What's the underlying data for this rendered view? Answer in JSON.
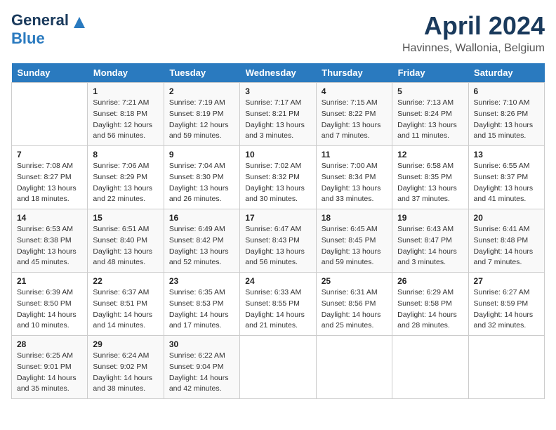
{
  "header": {
    "logo_general": "General",
    "logo_blue": "Blue",
    "month": "April 2024",
    "location": "Havinnes, Wallonia, Belgium"
  },
  "weekdays": [
    "Sunday",
    "Monday",
    "Tuesday",
    "Wednesday",
    "Thursday",
    "Friday",
    "Saturday"
  ],
  "weeks": [
    [
      {
        "day": "",
        "sunrise": "",
        "sunset": "",
        "daylight": ""
      },
      {
        "day": "1",
        "sunrise": "7:21 AM",
        "sunset": "8:18 PM",
        "daylight": "12 hours and 56 minutes."
      },
      {
        "day": "2",
        "sunrise": "7:19 AM",
        "sunset": "8:19 PM",
        "daylight": "12 hours and 59 minutes."
      },
      {
        "day": "3",
        "sunrise": "7:17 AM",
        "sunset": "8:21 PM",
        "daylight": "13 hours and 3 minutes."
      },
      {
        "day": "4",
        "sunrise": "7:15 AM",
        "sunset": "8:22 PM",
        "daylight": "13 hours and 7 minutes."
      },
      {
        "day": "5",
        "sunrise": "7:13 AM",
        "sunset": "8:24 PM",
        "daylight": "13 hours and 11 minutes."
      },
      {
        "day": "6",
        "sunrise": "7:10 AM",
        "sunset": "8:26 PM",
        "daylight": "13 hours and 15 minutes."
      }
    ],
    [
      {
        "day": "7",
        "sunrise": "7:08 AM",
        "sunset": "8:27 PM",
        "daylight": "13 hours and 18 minutes."
      },
      {
        "day": "8",
        "sunrise": "7:06 AM",
        "sunset": "8:29 PM",
        "daylight": "13 hours and 22 minutes."
      },
      {
        "day": "9",
        "sunrise": "7:04 AM",
        "sunset": "8:30 PM",
        "daylight": "13 hours and 26 minutes."
      },
      {
        "day": "10",
        "sunrise": "7:02 AM",
        "sunset": "8:32 PM",
        "daylight": "13 hours and 30 minutes."
      },
      {
        "day": "11",
        "sunrise": "7:00 AM",
        "sunset": "8:34 PM",
        "daylight": "13 hours and 33 minutes."
      },
      {
        "day": "12",
        "sunrise": "6:58 AM",
        "sunset": "8:35 PM",
        "daylight": "13 hours and 37 minutes."
      },
      {
        "day": "13",
        "sunrise": "6:55 AM",
        "sunset": "8:37 PM",
        "daylight": "13 hours and 41 minutes."
      }
    ],
    [
      {
        "day": "14",
        "sunrise": "6:53 AM",
        "sunset": "8:38 PM",
        "daylight": "13 hours and 45 minutes."
      },
      {
        "day": "15",
        "sunrise": "6:51 AM",
        "sunset": "8:40 PM",
        "daylight": "13 hours and 48 minutes."
      },
      {
        "day": "16",
        "sunrise": "6:49 AM",
        "sunset": "8:42 PM",
        "daylight": "13 hours and 52 minutes."
      },
      {
        "day": "17",
        "sunrise": "6:47 AM",
        "sunset": "8:43 PM",
        "daylight": "13 hours and 56 minutes."
      },
      {
        "day": "18",
        "sunrise": "6:45 AM",
        "sunset": "8:45 PM",
        "daylight": "13 hours and 59 minutes."
      },
      {
        "day": "19",
        "sunrise": "6:43 AM",
        "sunset": "8:47 PM",
        "daylight": "14 hours and 3 minutes."
      },
      {
        "day": "20",
        "sunrise": "6:41 AM",
        "sunset": "8:48 PM",
        "daylight": "14 hours and 7 minutes."
      }
    ],
    [
      {
        "day": "21",
        "sunrise": "6:39 AM",
        "sunset": "8:50 PM",
        "daylight": "14 hours and 10 minutes."
      },
      {
        "day": "22",
        "sunrise": "6:37 AM",
        "sunset": "8:51 PM",
        "daylight": "14 hours and 14 minutes."
      },
      {
        "day": "23",
        "sunrise": "6:35 AM",
        "sunset": "8:53 PM",
        "daylight": "14 hours and 17 minutes."
      },
      {
        "day": "24",
        "sunrise": "6:33 AM",
        "sunset": "8:55 PM",
        "daylight": "14 hours and 21 minutes."
      },
      {
        "day": "25",
        "sunrise": "6:31 AM",
        "sunset": "8:56 PM",
        "daylight": "14 hours and 25 minutes."
      },
      {
        "day": "26",
        "sunrise": "6:29 AM",
        "sunset": "8:58 PM",
        "daylight": "14 hours and 28 minutes."
      },
      {
        "day": "27",
        "sunrise": "6:27 AM",
        "sunset": "8:59 PM",
        "daylight": "14 hours and 32 minutes."
      }
    ],
    [
      {
        "day": "28",
        "sunrise": "6:25 AM",
        "sunset": "9:01 PM",
        "daylight": "14 hours and 35 minutes."
      },
      {
        "day": "29",
        "sunrise": "6:24 AM",
        "sunset": "9:02 PM",
        "daylight": "14 hours and 38 minutes."
      },
      {
        "day": "30",
        "sunrise": "6:22 AM",
        "sunset": "9:04 PM",
        "daylight": "14 hours and 42 minutes."
      },
      {
        "day": "",
        "sunrise": "",
        "sunset": "",
        "daylight": ""
      },
      {
        "day": "",
        "sunrise": "",
        "sunset": "",
        "daylight": ""
      },
      {
        "day": "",
        "sunrise": "",
        "sunset": "",
        "daylight": ""
      },
      {
        "day": "",
        "sunrise": "",
        "sunset": "",
        "daylight": ""
      }
    ]
  ]
}
